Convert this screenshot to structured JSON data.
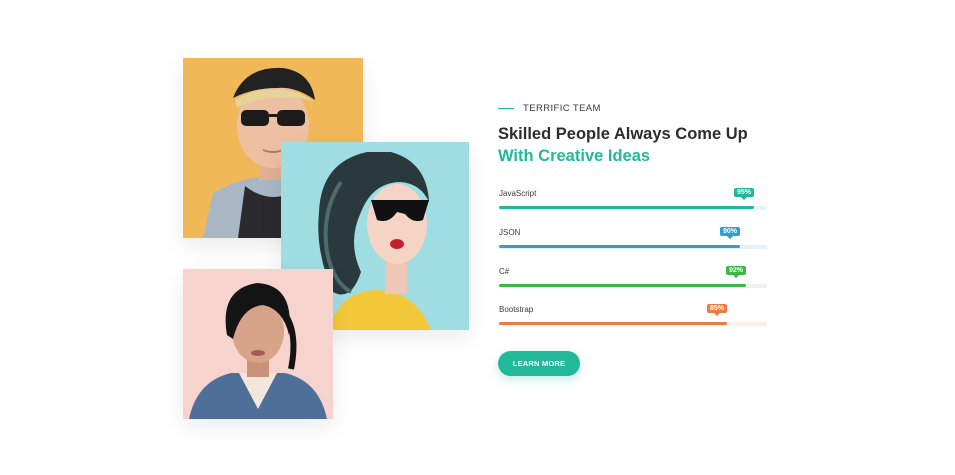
{
  "section": {
    "eyebrow": "TERRIFIC TEAM",
    "heading_line1": "Skilled People Always Come Up",
    "heading_line2": "With Creative Ideas",
    "accent_color": "#22b99a"
  },
  "skills": [
    {
      "name": "JavaScript",
      "percent_label": "95%",
      "percent": 95,
      "color": "#1fb99a",
      "track": "#e6f6f2"
    },
    {
      "name": "JSON",
      "percent_label": "90%",
      "percent": 90,
      "color": "#2a9fd8",
      "track": "#e7f3fb"
    },
    {
      "name": "C#",
      "percent_label": "92%",
      "percent": 92,
      "color": "#3cb84a",
      "track": "#e9f6ea"
    },
    {
      "name": "Bootstrap",
      "percent_label": "85%",
      "percent": 85,
      "color": "#f07b3f",
      "track": "#fcefe8"
    }
  ],
  "cta": {
    "label": "LEARN MORE"
  },
  "photos": [
    {
      "subject": "man-with-beanie-and-sunglasses",
      "bg": "#f1b857"
    },
    {
      "subject": "woman-with-sunglasses",
      "bg": "#9fdde3"
    },
    {
      "subject": "woman-in-denim-jacket",
      "bg": "#f6d3cd"
    }
  ]
}
